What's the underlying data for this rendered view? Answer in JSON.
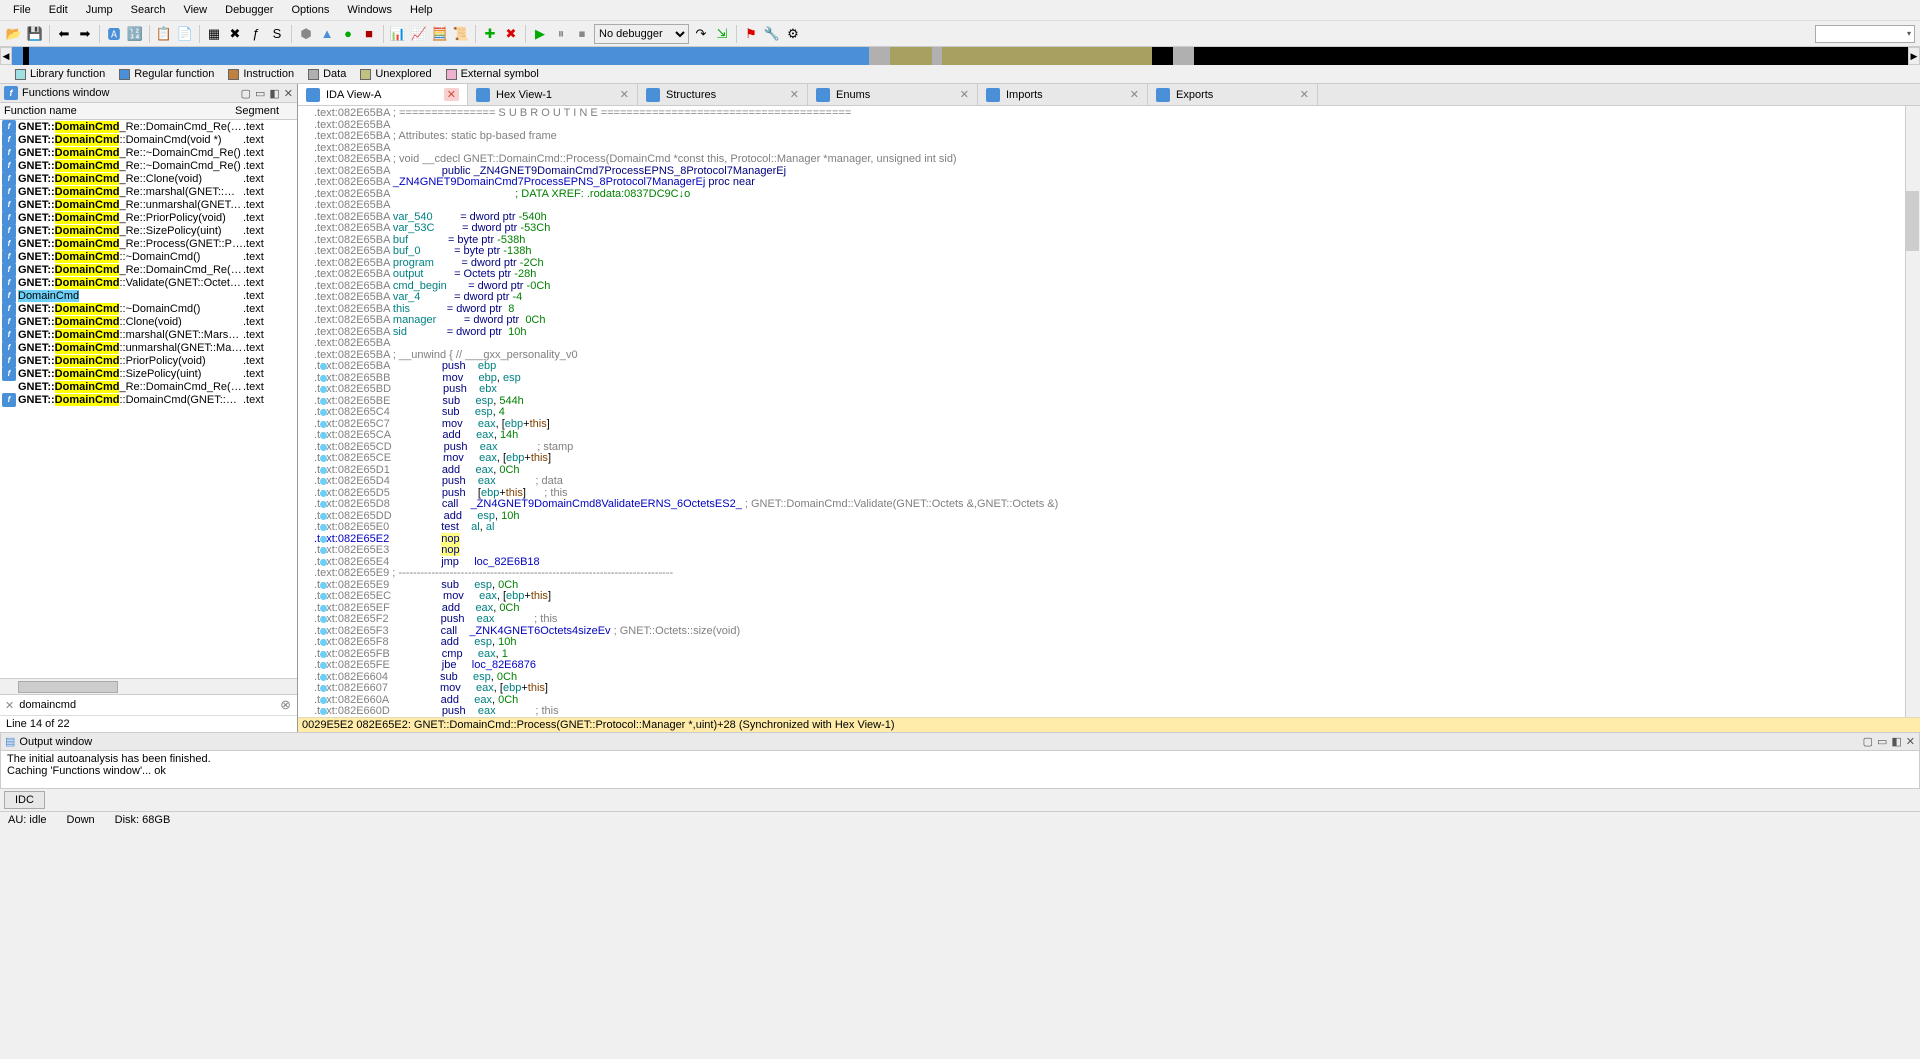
{
  "menu": [
    "File",
    "Edit",
    "Jump",
    "Search",
    "View",
    "Debugger",
    "Options",
    "Windows",
    "Help"
  ],
  "debugger_value": "No debugger",
  "legend": [
    {
      "label": "Library function",
      "color": "#a0e0e0"
    },
    {
      "label": "Regular function",
      "color": "#4a90d9"
    },
    {
      "label": "Instruction",
      "color": "#c08040"
    },
    {
      "label": "Data",
      "color": "#b0b0b0"
    },
    {
      "label": "Unexplored",
      "color": "#c0c080"
    },
    {
      "label": "External symbol",
      "color": "#f0b0d0"
    }
  ],
  "functions_window_title": "Functions window",
  "func_cols": {
    "c1": "Function name",
    "c2": "Segment"
  },
  "functions": [
    {
      "pre": "GNET::",
      "hl": "DomainCmd",
      "post": "_Re::DomainCmd_Re(void *)",
      "seg": ".text"
    },
    {
      "pre": "GNET::",
      "hl": "DomainCmd",
      "post": "::DomainCmd(void *)",
      "seg": ".text"
    },
    {
      "pre": "GNET::",
      "hl": "DomainCmd",
      "post": "_Re::~DomainCmd_Re()",
      "seg": ".text"
    },
    {
      "pre": "GNET::",
      "hl": "DomainCmd",
      "post": "_Re::~DomainCmd_Re()",
      "seg": ".text"
    },
    {
      "pre": "GNET::",
      "hl": "DomainCmd",
      "post": "_Re::Clone(void)",
      "seg": ".text"
    },
    {
      "pre": "GNET::",
      "hl": "DomainCmd",
      "post": "_Re::marshal(GNET::Marsh...",
      "seg": ".text"
    },
    {
      "pre": "GNET::",
      "hl": "DomainCmd",
      "post": "_Re::unmarshal(GNET::Mar...",
      "seg": ".text"
    },
    {
      "pre": "GNET::",
      "hl": "DomainCmd",
      "post": "_Re::PriorPolicy(void)",
      "seg": ".text"
    },
    {
      "pre": "GNET::",
      "hl": "DomainCmd",
      "post": "_Re::SizePolicy(uint)",
      "seg": ".text"
    },
    {
      "pre": "GNET::",
      "hl": "DomainCmd",
      "post": "_Re::Process(GNET::Protoc...",
      "seg": ".text"
    },
    {
      "pre": "GNET::",
      "hl": "DomainCmd",
      "post": "::~DomainCmd()",
      "seg": ".text"
    },
    {
      "pre": "GNET::",
      "hl": "DomainCmd",
      "post": "_Re::DomainCmd_Re(GNE...",
      "seg": ".text"
    },
    {
      "pre": "GNET::",
      "hl": "DomainCmd",
      "post": "::Validate(GNET::Octets &,...",
      "seg": ".text"
    },
    {
      "pre": "",
      "hl": "",
      "post": "",
      "seg": ".text",
      "sel": true,
      "selpre": "",
      "selhl": "DomainCmd"
    },
    {
      "pre": "GNET::",
      "hl": "DomainCmd",
      "post": "::~DomainCmd()",
      "seg": ".text"
    },
    {
      "pre": "GNET::",
      "hl": "DomainCmd",
      "post": "::Clone(void)",
      "seg": ".text"
    },
    {
      "pre": "GNET::",
      "hl": "DomainCmd",
      "post": "::marshal(GNET::Marshal::O...",
      "seg": ".text"
    },
    {
      "pre": "GNET::",
      "hl": "DomainCmd",
      "post": "::unmarshal(GNET::Marshal...",
      "seg": ".text"
    },
    {
      "pre": "GNET::",
      "hl": "DomainCmd",
      "post": "::PriorPolicy(void)",
      "seg": ".text"
    },
    {
      "pre": "GNET::",
      "hl": "DomainCmd",
      "post": "::SizePolicy(uint)",
      "seg": ".text"
    },
    {
      "pre": "GNET::",
      "hl": "DomainCmd",
      "post": "_Re::DomainCmd_Re(GNET::Octe...",
      "seg": ".text",
      "noicon": true
    },
    {
      "pre": "GNET::",
      "hl": "DomainCmd",
      "post": "::DomainCmd(GNET::Domai...",
      "seg": ".text"
    }
  ],
  "filter_value": "domaincmd",
  "line_status": "Line 14 of 22",
  "tabs": [
    {
      "label": "IDA View-A",
      "active": true,
      "iconColor": "#4a90d9"
    },
    {
      "label": "Hex View-1",
      "iconColor": "#4a90d9"
    },
    {
      "label": "Structures",
      "iconColor": "#4a90d9"
    },
    {
      "label": "Enums",
      "iconColor": "#4a90d9"
    },
    {
      "label": "Imports",
      "iconColor": "#4a90d9"
    },
    {
      "label": "Exports",
      "iconColor": "#4a90d9"
    }
  ],
  "disasm": [
    {
      "a": "082E65BA",
      "t": "; =============== S U B R O U T I N E =======================================",
      "cls": "c-gray"
    },
    {
      "a": "082E65BA",
      "t": ""
    },
    {
      "a": "082E65BA",
      "t": "; Attributes: static bp-based frame",
      "cls": "c-gray"
    },
    {
      "a": "082E65BA",
      "t": ""
    },
    {
      "a": "082E65BA",
      "t": "; void __cdecl GNET::DomainCmd::Process(DomainCmd *const this, Protocol::Manager *manager, unsigned int sid)",
      "cls": "c-gray"
    },
    {
      "a": "082E65BA",
      "t": "                public _ZN4GNET9DomainCmd7ProcessEPNS_8Protocol7ManagerEj",
      "cls": "c-navy"
    },
    {
      "a": "082E65BA",
      "rawhtml": "<span class='c-blue'>_ZN4GNET9DomainCmd7ProcessEPNS_8Protocol7ManagerEj</span> <span class='c-navy'>proc near</span>"
    },
    {
      "a": "082E65BA",
      "t": "                                        ; DATA XREF: .rodata:0837DC9C↓o",
      "cls": "c-green",
      "pad": true
    },
    {
      "a": "082E65BA",
      "t": ""
    },
    {
      "a": "082E65BA",
      "rawhtml": "<span class='c-teal'>var_540</span>         <span class='c-navy'>= dword ptr</span> <span class='c-green'>-540h</span>"
    },
    {
      "a": "082E65BA",
      "rawhtml": "<span class='c-teal'>var_53C</span>         <span class='c-navy'>= dword ptr</span> <span class='c-green'>-53Ch</span>"
    },
    {
      "a": "082E65BA",
      "rawhtml": "<span class='c-teal'>buf</span>             <span class='c-navy'>= byte ptr</span> <span class='c-green'>-538h</span>"
    },
    {
      "a": "082E65BA",
      "rawhtml": "<span class='c-teal'>buf_0</span>           <span class='c-navy'>= byte ptr</span> <span class='c-green'>-138h</span>"
    },
    {
      "a": "082E65BA",
      "rawhtml": "<span class='c-teal'>program</span>         <span class='c-navy'>= dword ptr</span> <span class='c-green'>-2Ch</span>"
    },
    {
      "a": "082E65BA",
      "rawhtml": "<span class='c-teal'>output</span>          <span class='c-navy'>= Octets ptr</span> <span class='c-green'>-28h</span>"
    },
    {
      "a": "082E65BA",
      "rawhtml": "<span class='c-teal'>cmd_begin</span>       <span class='c-navy'>= dword ptr</span> <span class='c-green'>-0Ch</span>"
    },
    {
      "a": "082E65BA",
      "rawhtml": "<span class='c-teal'>var_4</span>           <span class='c-navy'>= dword ptr</span> <span class='c-green'>-4</span>"
    },
    {
      "a": "082E65BA",
      "rawhtml": "<span class='c-teal'>this</span>            <span class='c-navy'>= dword ptr</span>  <span class='c-green'>8</span>"
    },
    {
      "a": "082E65BA",
      "rawhtml": "<span class='c-teal'>manager</span>         <span class='c-navy'>= dword ptr</span>  <span class='c-green'>0Ch</span>"
    },
    {
      "a": "082E65BA",
      "rawhtml": "<span class='c-teal'>sid</span>             <span class='c-navy'>= dword ptr</span>  <span class='c-green'>10h</span>"
    },
    {
      "a": "082E65BA",
      "t": ""
    },
    {
      "a": "082E65BA",
      "rawhtml": "<span class='c-gray'>; __unwind { // ___gxx_personality_v0</span>"
    },
    {
      "a": "082E65BA",
      "dot": true,
      "rawhtml": "                <span class='c-navy'>push</span>    <span class='c-teal'>ebp</span>"
    },
    {
      "a": "082E65BB",
      "dot": true,
      "rawhtml": "                <span class='c-navy'>mov</span>     <span class='c-teal'>ebp</span>, <span class='c-teal'>esp</span>"
    },
    {
      "a": "082E65BD",
      "dot": true,
      "rawhtml": "                <span class='c-navy'>push</span>    <span class='c-teal'>ebx</span>"
    },
    {
      "a": "082E65BE",
      "dot": true,
      "rawhtml": "                <span class='c-navy'>sub</span>     <span class='c-teal'>esp</span>, <span class='c-green'>544h</span>"
    },
    {
      "a": "082E65C4",
      "dot": true,
      "rawhtml": "                <span class='c-navy'>sub</span>     <span class='c-teal'>esp</span>, <span class='c-green'>4</span>"
    },
    {
      "a": "082E65C7",
      "dot": true,
      "rawhtml": "                <span class='c-navy'>mov</span>     <span class='c-teal'>eax</span>, [<span class='c-teal'>ebp</span>+<span class='c-brown'>this</span>]"
    },
    {
      "a": "082E65CA",
      "dot": true,
      "rawhtml": "                <span class='c-navy'>add</span>     <span class='c-teal'>eax</span>, <span class='c-green'>14h</span>"
    },
    {
      "a": "082E65CD",
      "dot": true,
      "rawhtml": "                <span class='c-navy'>push</span>    <span class='c-teal'>eax</span>             <span class='c-gray'>; stamp</span>"
    },
    {
      "a": "082E65CE",
      "dot": true,
      "rawhtml": "                <span class='c-navy'>mov</span>     <span class='c-teal'>eax</span>, [<span class='c-teal'>ebp</span>+<span class='c-brown'>this</span>]"
    },
    {
      "a": "082E65D1",
      "dot": true,
      "rawhtml": "                <span class='c-navy'>add</span>     <span class='c-teal'>eax</span>, <span class='c-green'>0Ch</span>"
    },
    {
      "a": "082E65D4",
      "dot": true,
      "rawhtml": "                <span class='c-navy'>push</span>    <span class='c-teal'>eax</span>             <span class='c-gray'>; data</span>"
    },
    {
      "a": "082E65D5",
      "dot": true,
      "rawhtml": "                <span class='c-navy'>push</span>    [<span class='c-teal'>ebp</span>+<span class='c-brown'>this</span>]      <span class='c-gray'>; this</span>"
    },
    {
      "a": "082E65D8",
      "dot": true,
      "rawhtml": "                <span class='c-navy'>call</span>    <span class='c-blue'>_ZN4GNET9DomainCmd8ValidateERNS_6OctetsES2_</span> <span class='c-gray'>; GNET::DomainCmd::Validate(GNET::Octets &,GNET::Octets &)</span>"
    },
    {
      "a": "082E65DD",
      "dot": true,
      "rawhtml": "                <span class='c-navy'>add</span>     <span class='c-teal'>esp</span>, <span class='c-green'>10h</span>"
    },
    {
      "a": "082E65E0",
      "dot": true,
      "rawhtml": "                <span class='c-navy'>test</span>    <span class='c-teal'>al</span>, <span class='c-teal'>al</span>"
    },
    {
      "a": "082E65E2",
      "dot": true,
      "blue": true,
      "rawhtml": "                <span class='hl-nop c-navy'>nop</span>"
    },
    {
      "a": "082E65E3",
      "dot": true,
      "rawhtml": "                <span class='hl-nop c-navy'>nop</span>"
    },
    {
      "a": "082E65E4",
      "dot": true,
      "rawhtml": "                <span class='c-navy'>jmp</span>     <span class='c-blue'>loc_82E6B18</span>"
    },
    {
      "a": "082E65E9",
      "t": "; ---------------------------------------------------------------------------",
      "cls": "c-gray"
    },
    {
      "a": "082E65E9",
      "dot": true,
      "rawhtml": "                <span class='c-navy'>sub</span>     <span class='c-teal'>esp</span>, <span class='c-green'>0Ch</span>"
    },
    {
      "a": "082E65EC",
      "dot": true,
      "rawhtml": "                <span class='c-navy'>mov</span>     <span class='c-teal'>eax</span>, [<span class='c-teal'>ebp</span>+<span class='c-brown'>this</span>]"
    },
    {
      "a": "082E65EF",
      "dot": true,
      "rawhtml": "                <span class='c-navy'>add</span>     <span class='c-teal'>eax</span>, <span class='c-green'>0Ch</span>"
    },
    {
      "a": "082E65F2",
      "dot": true,
      "rawhtml": "                <span class='c-navy'>push</span>    <span class='c-teal'>eax</span>             <span class='c-gray'>; this</span>"
    },
    {
      "a": "082E65F3",
      "dot": true,
      "rawhtml": "                <span class='c-navy'>call</span>    <span class='c-blue'>_ZNK4GNET6Octets4sizeEv</span> <span class='c-gray'>; GNET::Octets::size(void)</span>"
    },
    {
      "a": "082E65F8",
      "dot": true,
      "rawhtml": "                <span class='c-navy'>add</span>     <span class='c-teal'>esp</span>, <span class='c-green'>10h</span>"
    },
    {
      "a": "082E65FB",
      "dot": true,
      "rawhtml": "                <span class='c-navy'>cmp</span>     <span class='c-teal'>eax</span>, <span class='c-green'>1</span>"
    },
    {
      "a": "082E65FE",
      "dot": true,
      "rawhtml": "                <span class='c-navy'>jbe</span>     <span class='c-blue'>loc_82E6876</span>"
    },
    {
      "a": "082E6604",
      "dot": true,
      "rawhtml": "                <span class='c-navy'>sub</span>     <span class='c-teal'>esp</span>, <span class='c-green'>0Ch</span>"
    },
    {
      "a": "082E6607",
      "dot": true,
      "rawhtml": "                <span class='c-navy'>mov</span>     <span class='c-teal'>eax</span>, [<span class='c-teal'>ebp</span>+<span class='c-brown'>this</span>]"
    },
    {
      "a": "082E660A",
      "dot": true,
      "rawhtml": "                <span class='c-navy'>add</span>     <span class='c-teal'>eax</span>, <span class='c-green'>0Ch</span>"
    },
    {
      "a": "082E660D",
      "dot": true,
      "rawhtml": "                <span class='c-navy'>push</span>    <span class='c-teal'>eax</span>             <span class='c-gray'>; this</span>"
    }
  ],
  "disasm_status": "0029E5E2 082E65E2: GNET::DomainCmd::Process(GNET::Protocol::Manager *,uint)+28 (Synchronized with Hex View-1)",
  "output_title": "Output window",
  "output_lines": [
    "The initial autoanalysis has been finished.",
    "Caching 'Functions window'... ok"
  ],
  "idc_label": "IDC",
  "status": {
    "au": "AU: idle",
    "down": "Down",
    "disk": "Disk: 68GB"
  }
}
